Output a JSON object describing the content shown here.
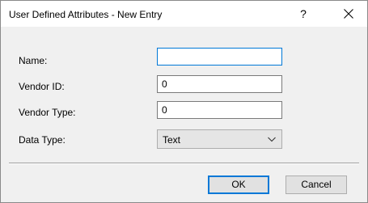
{
  "window": {
    "title": "User Defined Attributes - New Entry",
    "help_label": "?",
    "close_icon": "close-icon"
  },
  "form": {
    "name_label": "Name:",
    "name_value": "",
    "vendor_id_label": "Vendor ID:",
    "vendor_id_value": "0",
    "vendor_type_label": "Vendor Type:",
    "vendor_type_value": "0",
    "data_type_label": "Data Type:",
    "data_type_value": "Text",
    "data_type_icon": "chevron-down-icon"
  },
  "buttons": {
    "ok_label": "OK",
    "cancel_label": "Cancel"
  },
  "colors": {
    "focus_accent": "#0078d7",
    "dialog_background": "#f0f0f0"
  }
}
